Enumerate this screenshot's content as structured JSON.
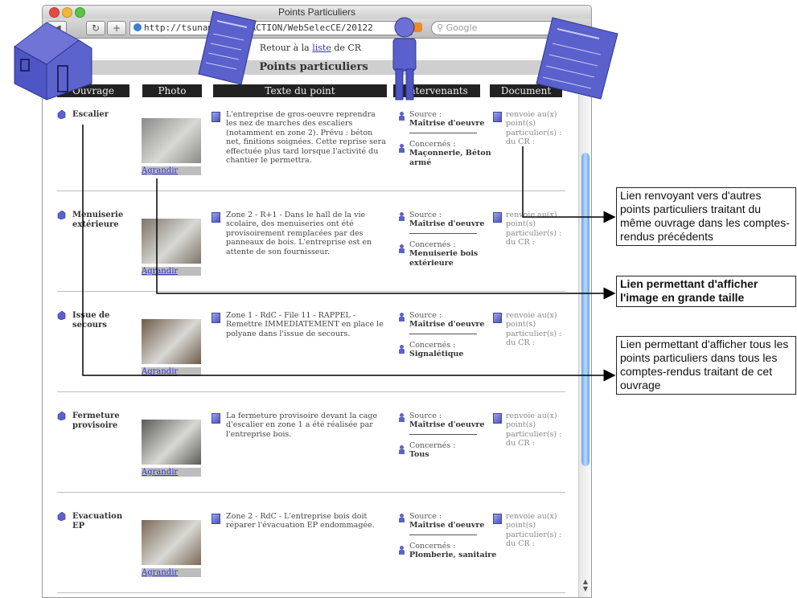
{
  "window": {
    "title": "Points Particuliers",
    "url": "http://tsunami              80/4DACTION/WebSelecCE/20122",
    "search_placeholder": "Google"
  },
  "page": {
    "retour_prefix": "Retour à la ",
    "retour_link": "liste",
    "retour_suffix": " de CR",
    "section_title": "Points particuliers",
    "headers": {
      "ouvrage": "Ouvrage",
      "photo": "Photo",
      "texte": "Texte du point",
      "intervenants": "Intervenants",
      "document": "Document"
    },
    "source_label": "Source :",
    "concernes_label": "Concernés :",
    "agrandir_label": "Agrandir",
    "document_text": "renvoie au(x) point(s) particulier(s) : du CR :",
    "rows": [
      {
        "ouvrage": "Escalier",
        "texte": "L'entreprise de gros-oeuvre reprendra les nez de marches des escaliers (notamment en zone 2). Prévu : béton net, finitions soignées. Cette reprise sera effectuée plus tard lorsque l'activité du chantier le permettra.",
        "source": "Maîtrise d'oeuvre",
        "concernes": "Maçonnerie, Béton armé",
        "photo_color": "#8a8a88"
      },
      {
        "ouvrage": "Menuiserie extérieure",
        "texte": "Zone 2 - R+1 - Dans le hall de la vie scolaire, des menuiseries ont été provisoirement remplacées par des panneaux de bois. L'entreprise est en attente de son fournisseur.",
        "source": "Maîtrise d'oeuvre",
        "concernes": "Menuiserie bois extérieure",
        "photo_color": "#7d7468"
      },
      {
        "ouvrage": "Issue de secours",
        "texte": "Zone 1 - RdC - File 11 - RAPPEL - Remettre IMMEDIATEMENT en place le polyane dans l'issue de secours.",
        "source": "Maîtrise d'oeuvre",
        "concernes": "Signalétique",
        "photo_color": "#6e5b4a"
      },
      {
        "ouvrage": "Fermeture provisoire",
        "texte": "La fermeture provisoire devant la cage d'escalier en zone 1 a été réalisée par l'entreprise bois.",
        "source": "Maîtrise d'oeuvre",
        "concernes": "Tous",
        "photo_color": "#5a5a58"
      },
      {
        "ouvrage": "Evacuation EP",
        "texte": "Zone 2 - RdC - L'entreprise bois doit réparer l'évacuation EP endommagée.",
        "source": "Maîtrise d'oeuvre",
        "concernes": "Plomberie, sanitaire",
        "photo_color": "#7a6a58"
      }
    ]
  },
  "callouts": {
    "c1": "Lien renvoyant vers d'autres points particuliers traitant du même ouvrage dans les comptes-rendus précédents",
    "c2": "Lien permettant d'afficher l'image en grande taille",
    "c3": "Lien permettant d'afficher tous les points particuliers dans tous les comptes-rendus traitant de cet ouvrage"
  },
  "icons": {
    "house": "house-icon",
    "document": "document-icon",
    "person": "person-icon",
    "globe": "globe-icon",
    "rss": "rss-icon",
    "search": "search-icon"
  },
  "colors": {
    "accent": "#5b62c9",
    "link": "#3333cc",
    "header_bg": "#222222",
    "scroll_thumb": "#6aa7e8"
  }
}
